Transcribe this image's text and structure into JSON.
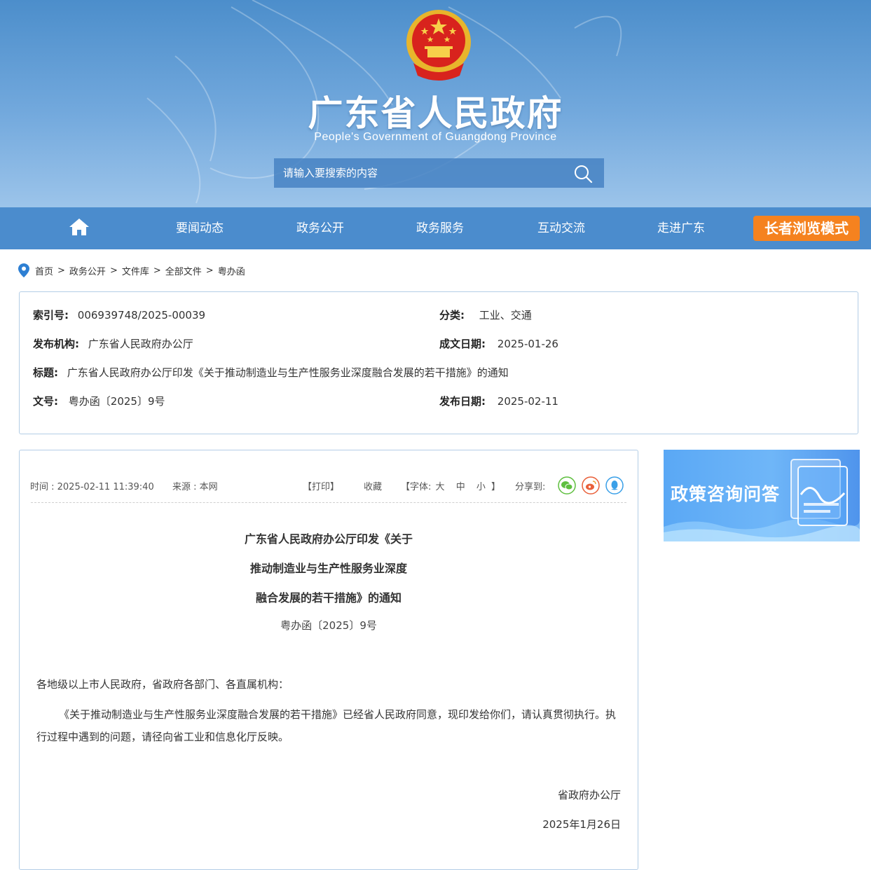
{
  "header": {
    "title": "广东省人民政府",
    "subtitle": "People's Government of Guangdong Province",
    "search_placeholder": "请输入要搜索的内容"
  },
  "nav": {
    "items": [
      "要闻动态",
      "政务公开",
      "政务服务",
      "互动交流",
      "走进广东"
    ],
    "elder_mode": "长者浏览模式"
  },
  "breadcrumb": [
    "首页",
    "政务公开",
    "文件库",
    "全部文件",
    "粤办函"
  ],
  "meta": {
    "index_label": "索引号:",
    "index_value": "006939748/2025-00039",
    "category_label": "分类:",
    "category_value": "工业、交通",
    "publisher_label": "发布机构:",
    "publisher_value": "广东省人民政府办公厅",
    "created_label": "成文日期:",
    "created_value": "2025-01-26",
    "title_label": "标题:",
    "title_value": "广东省人民政府办公厅印发《关于推动制造业与生产性服务业深度融合发展的若干措施》的通知",
    "docno_label": "文号:",
    "docno_value": "粤办函〔2025〕9号",
    "published_label": "发布日期:",
    "published_value": "2025-02-11"
  },
  "article": {
    "time": "时间 : 2025-02-11 11:39:40",
    "source": "来源 : 本网",
    "print": "【打印】",
    "favorite": "收藏",
    "font_prefix": "【字体:",
    "font_large": "大",
    "font_medium": "中",
    "font_small": "小",
    "font_suffix": "】",
    "share_label": "分享到:",
    "title_line1": "广东省人民政府办公厅印发《关于",
    "title_line2": "推动制造业与生产性服务业深度",
    "title_line3": "融合发展的若干措施》的通知",
    "doc_number": "粤办函〔2025〕9号",
    "salutation": "各地级以上市人民政府，省政府各部门、各直属机构：",
    "paragraph": "《关于推动制造业与生产性服务业深度融合发展的若干措施》已经省人民政府同意，现印发给你们，请认真贯彻执行。执行过程中遇到的问题，请径向省工业和信息化厅反映。",
    "signature": "省政府办公厅",
    "date": "2025年1月26日"
  },
  "banner": {
    "text": "政策咨询问答"
  },
  "colors": {
    "nav": "#4b8ccd",
    "elder": "#f5821f",
    "border": "#b3cde6"
  }
}
